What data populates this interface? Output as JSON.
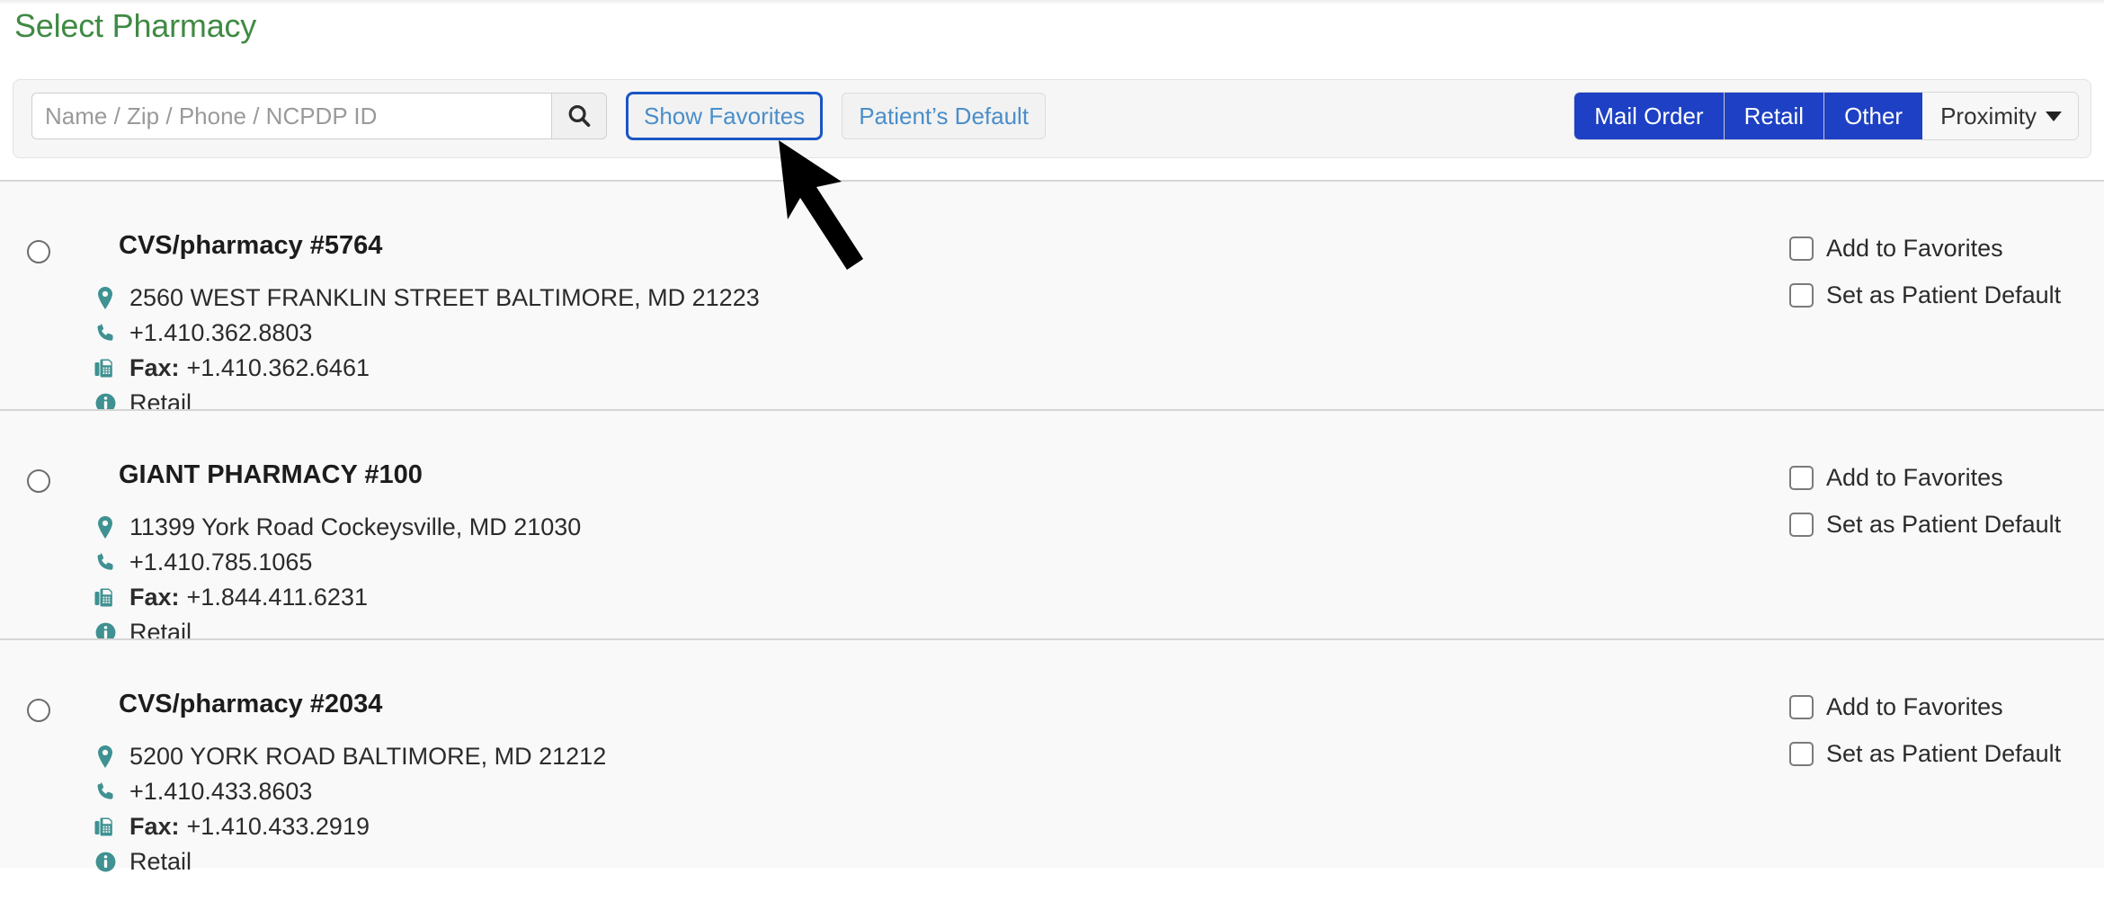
{
  "page": {
    "title": "Select Pharmacy",
    "title_color": "#3f8a43"
  },
  "toolbar": {
    "search": {
      "placeholder": "Name / Zip / Phone / NCPDP ID",
      "value": "",
      "icon": "search-icon",
      "button_label": ""
    },
    "show_favorites_label": "Show Favorites",
    "patients_default_label": "Patient’s Default",
    "filters": [
      {
        "label": "Mail Order",
        "active": true
      },
      {
        "label": "Retail",
        "active": true
      },
      {
        "label": "Other",
        "active": true
      }
    ],
    "sort": {
      "label": "Proximity",
      "icon": "chevron-down-icon"
    },
    "colors": {
      "active_filter_bg": "#1d40c4",
      "link_text": "#4a8ec9",
      "focus_ring": "#1a56c4"
    }
  },
  "annotation": {
    "type": "pointer-arrow",
    "points_to": "show-favorites-button"
  },
  "row_actions": {
    "add_to_favorites_label": "Add to Favorites",
    "set_as_patient_default_label": "Set as Patient Default"
  },
  "icons": {
    "address": "location-pin-icon",
    "phone": "phone-icon",
    "fax": "fax-icon",
    "type": "info-circle-icon",
    "icon_color": "#3f9192"
  },
  "results": [
    {
      "name": "CVS/pharmacy #5764",
      "address": "2560 WEST FRANKLIN STREET BALTIMORE, MD 21223",
      "phone": "+1.410.362.8803",
      "fax_label": "Fax:",
      "fax": "+1.410.362.6461",
      "type": "Retail",
      "selected": false,
      "add_to_favorites_checked": false,
      "set_as_patient_default_checked": false
    },
    {
      "name": "GIANT PHARMACY #100",
      "address": "11399 York Road Cockeysville, MD 21030",
      "phone": "+1.410.785.1065",
      "fax_label": "Fax:",
      "fax": "+1.844.411.6231",
      "type": "Retail",
      "selected": false,
      "add_to_favorites_checked": false,
      "set_as_patient_default_checked": false
    },
    {
      "name": "CVS/pharmacy #2034",
      "address": "5200 YORK ROAD BALTIMORE, MD 21212",
      "phone": "+1.410.433.8603",
      "fax_label": "Fax:",
      "fax": "+1.410.433.2919",
      "type": "Retail",
      "selected": false,
      "add_to_favorites_checked": false,
      "set_as_patient_default_checked": false
    }
  ]
}
